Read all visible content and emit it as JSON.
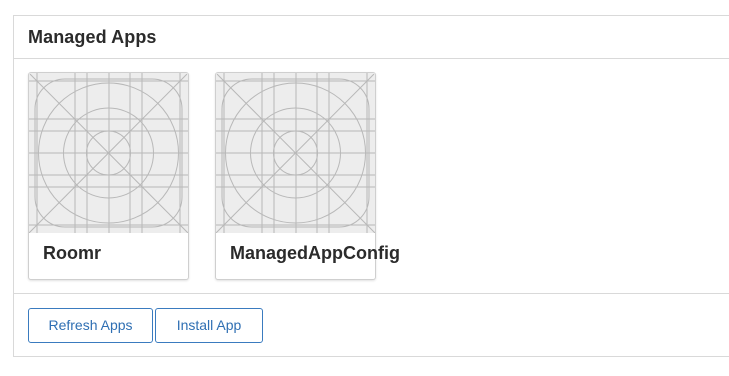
{
  "panel": {
    "title": "Managed Apps"
  },
  "apps": [
    {
      "name": "Roomr",
      "icon": "app-icon-template-grid"
    },
    {
      "name": "ManagedAppConfig",
      "icon": "app-icon-template-grid"
    }
  ],
  "footer": {
    "refresh_label": "Refresh Apps",
    "install_label": "Install App"
  },
  "colors": {
    "accent": "#2f6fb3",
    "border": "#d9d9d9",
    "icon_background": "#ededed",
    "icon_lines": "#b8b8b8"
  }
}
